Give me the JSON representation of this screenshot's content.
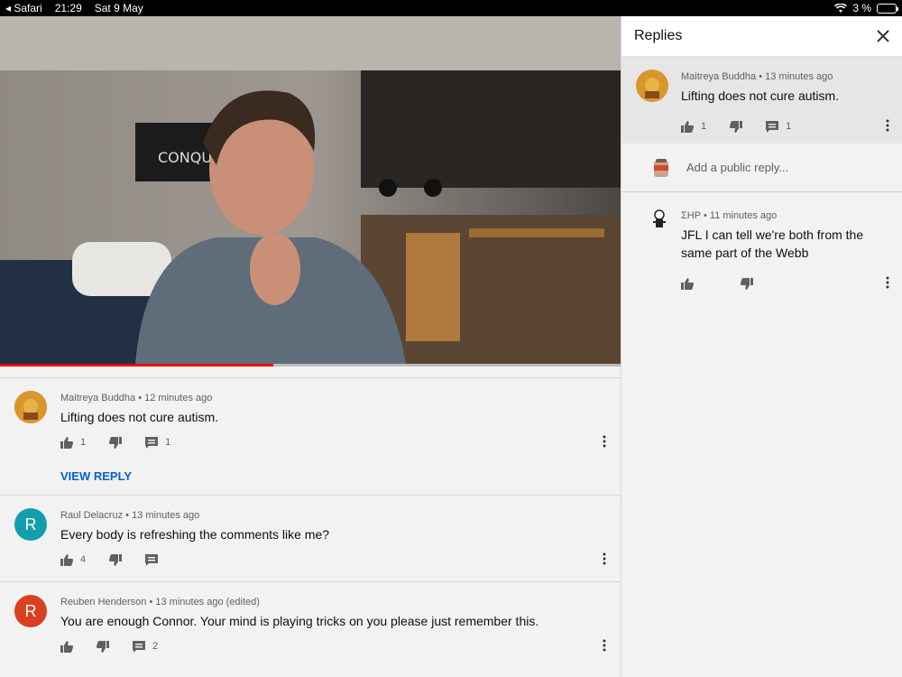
{
  "status_bar": {
    "app": "Safari",
    "time": "21:29",
    "date": "Sat 9 May",
    "battery": "3 %"
  },
  "video": {
    "progress": 0.44,
    "poster_text": "CONQUE"
  },
  "comments": [
    {
      "author": "Maitreya Buddha",
      "time": "12 minutes ago",
      "text": "Lifting does not cure autism.",
      "likes": "1",
      "replies": "1",
      "view_reply": "VIEW REPLY",
      "avatar_color": "#b8742a"
    },
    {
      "author": "Raul Delacruz",
      "time": "13 minutes ago",
      "text": "Every body is refreshing the comments like me?",
      "likes": "4",
      "replies": "",
      "avatar_letter": "R",
      "avatar_color": "#129eaf"
    },
    {
      "author": "Reuben Henderson",
      "time": "13 minutes ago (edited)",
      "text": "You are enough Connor. Your mind is playing tricks on you please just remember this.",
      "likes": "",
      "replies": "2",
      "avatar_letter": "R",
      "avatar_color": "#d9401f"
    }
  ],
  "replies_panel": {
    "title": "Replies",
    "parent": {
      "author": "Maitreya Buddha",
      "time": "13 minutes ago",
      "text": "Lifting does not cure autism.",
      "likes": "1",
      "replies": "1"
    },
    "add_reply_placeholder": "Add a public reply...",
    "reply": {
      "author": "ΣΗP",
      "time": "11 minutes ago",
      "text": "JFL I can tell we're both from the same part of the Webb"
    }
  },
  "icons": [
    "wifi-icon",
    "battery-icon",
    "close-icon",
    "thumb-up-icon",
    "thumb-down-icon",
    "reply-icon",
    "more-vert-icon"
  ]
}
